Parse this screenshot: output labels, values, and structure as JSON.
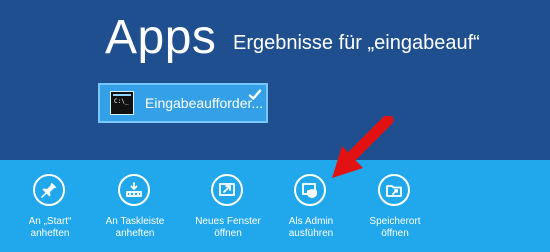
{
  "header": {
    "title": "Apps",
    "results": "Ergebnisse für „eingabeauf“"
  },
  "result": {
    "label": "Eingabeaufforder...",
    "icon": "command-prompt-icon",
    "status_icon": "check-icon"
  },
  "actions": [
    {
      "label": "An „Start“\nanheften",
      "icon": "pin-icon"
    },
    {
      "label": "An Taskleiste\nanheften",
      "icon": "taskbar-pin-icon"
    },
    {
      "label": "Neues Fenster\nöffnen",
      "icon": "new-window-icon"
    },
    {
      "label": "Als Admin\nausführen",
      "icon": "admin-shield-icon"
    },
    {
      "label": "Speicherort\nöffnen",
      "icon": "folder-location-icon"
    }
  ],
  "colors": {
    "background": "#1f4f8f",
    "command_bar": "#20a7ec",
    "selection": "#33a0e8",
    "arrow": "#e31212"
  }
}
